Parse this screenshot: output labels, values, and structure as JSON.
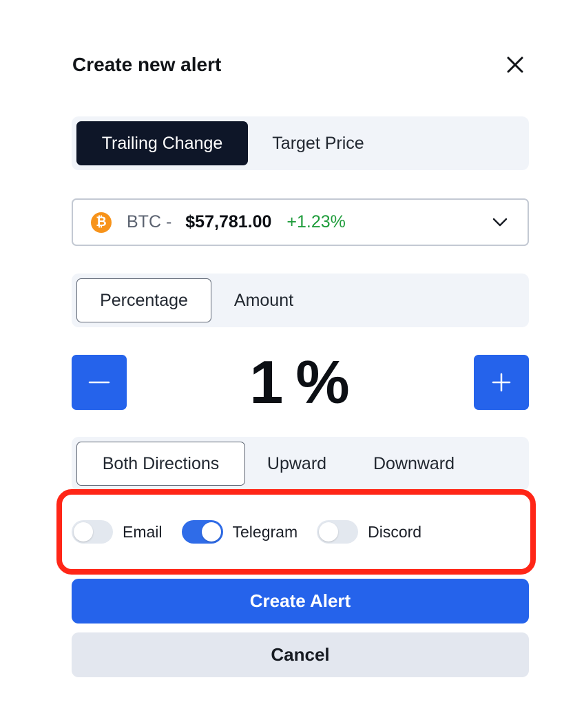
{
  "header": {
    "title": "Create new alert",
    "close_icon": "close-icon"
  },
  "alert_type_tabs": {
    "items": [
      {
        "label": "Trailing Change",
        "active": true
      },
      {
        "label": "Target Price",
        "active": false
      }
    ]
  },
  "coin_select": {
    "icon": "bitcoin-icon",
    "icon_glyph": "₿",
    "symbol": "BTC -",
    "price": "$57,781.00",
    "change": "+1.23%",
    "change_color": "#1f9c3b",
    "chevron_icon": "chevron-down-icon"
  },
  "mode_tabs": {
    "items": [
      {
        "label": "Percentage",
        "active": true
      },
      {
        "label": "Amount",
        "active": false
      }
    ]
  },
  "stepper": {
    "value": "1",
    "unit": "%",
    "minus_icon": "minus-icon",
    "plus_icon": "plus-icon"
  },
  "direction_tabs": {
    "items": [
      {
        "label": "Both Directions",
        "active": true
      },
      {
        "label": "Upward",
        "active": false
      },
      {
        "label": "Downward",
        "active": false
      }
    ]
  },
  "notifications": {
    "items": [
      {
        "label": "Email",
        "enabled": false
      },
      {
        "label": "Telegram",
        "enabled": true
      },
      {
        "label": "Discord",
        "enabled": false
      }
    ]
  },
  "actions": {
    "create_label": "Create Alert",
    "cancel_label": "Cancel"
  },
  "colors": {
    "accent": "#2563eb",
    "dark_tab": "#0e1628",
    "highlight": "#ff2617",
    "bitcoin": "#f7931a"
  }
}
